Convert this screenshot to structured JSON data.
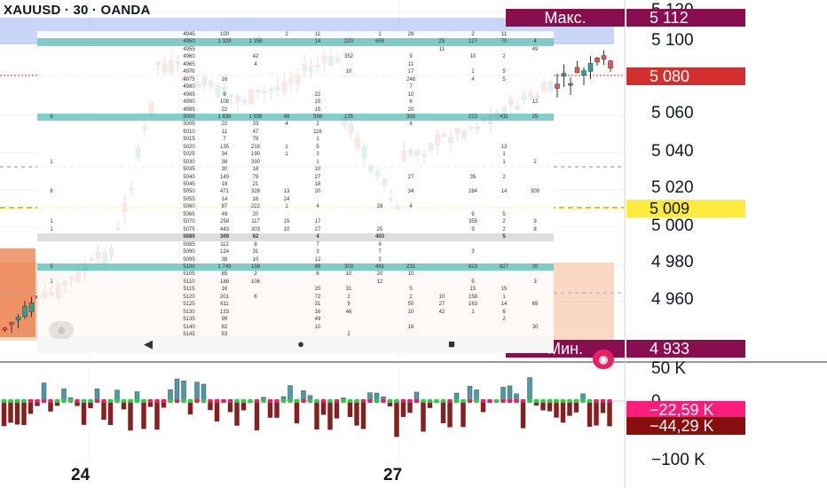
{
  "header": {
    "title": "XAUUSD · 30 · OANDA"
  },
  "price_axis": {
    "labels": [
      "5 120",
      "5 100",
      "5 060",
      "5 040",
      "5 020",
      "5 000",
      "4 980",
      "4 960"
    ],
    "max": {
      "name": "Макс.",
      "value": "5 112",
      "color": "#880e4f"
    },
    "current": {
      "value": "5 080",
      "color": "#d32f2f"
    },
    "level": {
      "value": "5 009",
      "color": "#ffeb3b"
    },
    "min": {
      "name": "Мин.",
      "value": "4 933",
      "color": "#880e4f"
    }
  },
  "indicator_axis": {
    "labels": [
      "50 K",
      "0",
      "−100 K"
    ],
    "badge_pos": {
      "value": "−22,59 K",
      "color": "#ff1d7a"
    },
    "badge_neg": {
      "value": "−44,29 K",
      "color": "#880e0e"
    }
  },
  "time_axis": {
    "labels": [
      "24",
      "27"
    ]
  },
  "dom": {
    "rows": [
      {
        "p": "4945",
        "c": [
          "",
          "100",
          "",
          "2",
          "11",
          "",
          "1",
          "28",
          "",
          "2",
          "11",
          "",
          ""
        ]
      },
      {
        "p": "4950",
        "c": [
          "",
          "1 329",
          "1 158",
          "",
          "14",
          "220",
          "659",
          "",
          "25",
          "127",
          "70",
          "4",
          ""
        ],
        "hl": true
      },
      {
        "p": "4955",
        "c": [
          "",
          "",
          "",
          "",
          "",
          "",
          "",
          "",
          "11",
          "",
          "",
          "49",
          ""
        ]
      },
      {
        "p": "4960",
        "c": [
          "",
          "",
          "42",
          "",
          "",
          "352",
          "",
          "9",
          "",
          "10",
          "2",
          "",
          ""
        ]
      },
      {
        "p": "4965",
        "c": [
          "",
          "",
          "4",
          "",
          "",
          "",
          "",
          "11",
          "",
          "",
          "",
          "",
          ""
        ]
      },
      {
        "p": "4970",
        "c": [
          "",
          "",
          "",
          "",
          "",
          "10",
          "",
          "17",
          "",
          "1",
          "5",
          "",
          ""
        ]
      },
      {
        "p": "4975",
        "c": [
          "",
          "16",
          "",
          "",
          "",
          "",
          "",
          "248",
          "",
          "4",
          "5",
          "",
          ""
        ]
      },
      {
        "p": "4980",
        "c": [
          "",
          "",
          "",
          "",
          "",
          "",
          "",
          "7",
          "",
          "",
          "",
          "",
          ""
        ]
      },
      {
        "p": "4985",
        "c": [
          "",
          "9",
          "",
          "",
          "22",
          "",
          "",
          "10",
          "",
          "",
          "",
          "",
          ""
        ]
      },
      {
        "p": "4990",
        "c": [
          "",
          "108",
          "",
          "",
          "15",
          "",
          "",
          "6",
          "",
          "",
          "",
          "12",
          ""
        ]
      },
      {
        "p": "4995",
        "c": [
          "",
          "22",
          "",
          "",
          "15",
          "",
          "",
          "20",
          "",
          "",
          "",
          "",
          ""
        ]
      },
      {
        "p": "5000",
        "c": [
          "",
          "1 836",
          "1 938",
          "48",
          "556",
          "135",
          "",
          "355",
          "",
          "223",
          "411",
          "25",
          "6"
        ],
        "hl": true
      },
      {
        "p": "5005",
        "c": [
          "",
          "22",
          "33",
          "4",
          "2",
          "",
          "",
          "8",
          "",
          "",
          "",
          "",
          ""
        ]
      },
      {
        "p": "5010",
        "c": [
          "",
          "11",
          "47",
          "",
          "116",
          "",
          "",
          "",
          "",
          "",
          "",
          "",
          ""
        ]
      },
      {
        "p": "5015",
        "c": [
          "",
          "7",
          "79",
          "",
          "1",
          "",
          "",
          "",
          "",
          "",
          "",
          "",
          ""
        ]
      },
      {
        "p": "5020",
        "c": [
          "",
          "135",
          "218",
          "1",
          "5",
          "",
          "",
          "",
          "",
          "",
          "13",
          "",
          ""
        ]
      },
      {
        "p": "5025",
        "c": [
          "",
          "34",
          "190",
          "1",
          "3",
          "",
          "",
          "",
          "",
          "",
          "1",
          "",
          ""
        ]
      },
      {
        "p": "5030",
        "c": [
          "",
          "38",
          "330",
          "",
          "1",
          "",
          "",
          "",
          "",
          "",
          "1",
          "2",
          "1"
        ]
      },
      {
        "p": "5035",
        "c": [
          "",
          "30",
          "18",
          "",
          "10",
          "",
          "",
          "",
          "",
          "",
          "",
          "",
          ""
        ]
      },
      {
        "p": "5040",
        "c": [
          "",
          "149",
          "79",
          "",
          "27",
          "",
          "",
          "27",
          "",
          "35",
          "2",
          "",
          ""
        ]
      },
      {
        "p": "5045",
        "c": [
          "",
          "18",
          "21",
          "",
          "18",
          "",
          "",
          "",
          "",
          "",
          "",
          "",
          ""
        ]
      },
      {
        "p": "5050",
        "c": [
          "",
          "471",
          "328",
          "13",
          "20",
          "",
          "",
          "34",
          "",
          "284",
          "14",
          "309",
          "8"
        ]
      },
      {
        "p": "5055",
        "c": [
          "",
          "14",
          "16",
          "24",
          "",
          "",
          "",
          "",
          "",
          "",
          "",
          "",
          ""
        ]
      },
      {
        "p": "5060",
        "c": [
          "",
          "87",
          "222",
          "1",
          "4",
          "",
          "28",
          "4",
          "",
          "",
          "",
          "",
          ""
        ]
      },
      {
        "p": "5065",
        "c": [
          "",
          "49",
          "20",
          "",
          "",
          "",
          "",
          "",
          "",
          "9",
          "5",
          "",
          ""
        ]
      },
      {
        "p": "5070",
        "c": [
          "",
          "258",
          "117",
          "15",
          "17",
          "",
          "",
          "",
          "",
          "355",
          "2",
          "9",
          "1"
        ]
      },
      {
        "p": "5075",
        "c": [
          "",
          "443",
          "303",
          "10",
          "27",
          "",
          "25",
          "",
          "",
          "9",
          "2",
          "8",
          "1"
        ]
      },
      {
        "p": "5080",
        "c": [
          "",
          "309",
          "62",
          "",
          "4",
          "",
          "403",
          "",
          "",
          "",
          "5",
          "",
          ""
        ],
        "cur": true
      },
      {
        "p": "5085",
        "c": [
          "",
          "112",
          "8",
          "",
          "7",
          "",
          "4",
          "",
          "",
          "",
          "",
          "",
          ""
        ]
      },
      {
        "p": "5090",
        "c": [
          "",
          "124",
          "31",
          "",
          "3",
          "",
          "7",
          "",
          "",
          "3",
          "",
          "",
          ""
        ]
      },
      {
        "p": "5095",
        "c": [
          "",
          "38",
          "10",
          "",
          "12",
          "",
          "3",
          "",
          "",
          "",
          "",
          "",
          ""
        ]
      },
      {
        "p": "5100",
        "c": [
          "",
          "1 749",
          "158",
          "",
          "86",
          "303",
          "491",
          "231",
          "",
          "823",
          "827",
          "20",
          "5"
        ],
        "hl": true
      },
      {
        "p": "5105",
        "c": [
          "",
          "85",
          "2",
          "",
          "6",
          "10",
          "20",
          "10",
          "",
          "",
          "",
          "",
          ""
        ]
      },
      {
        "p": "5110",
        "c": [
          "",
          "188",
          "106",
          "",
          "",
          "",
          "12",
          "",
          "",
          "5",
          "",
          "3",
          "1"
        ]
      },
      {
        "p": "5115",
        "c": [
          "",
          "16",
          "",
          "",
          "20",
          "31",
          "",
          "5",
          "",
          "15",
          "15",
          "",
          ""
        ]
      },
      {
        "p": "5120",
        "c": [
          "",
          "201",
          "6",
          "",
          "72",
          "2",
          "",
          "2",
          "10",
          "158",
          "1",
          "",
          ""
        ]
      },
      {
        "p": "5125",
        "c": [
          "",
          "611",
          "",
          "",
          "31",
          "9",
          "",
          "50",
          "27",
          "163",
          "14",
          "65",
          ""
        ]
      },
      {
        "p": "5130",
        "c": [
          "",
          "133",
          "",
          "",
          "16",
          "46",
          "",
          "10",
          "42",
          "1",
          "6",
          "",
          ""
        ]
      },
      {
        "p": "5135",
        "c": [
          "",
          "99",
          "",
          "",
          "49",
          "",
          "",
          "",
          "",
          "",
          "2",
          "",
          ""
        ]
      },
      {
        "p": "5140",
        "c": [
          "",
          "82",
          "",
          "",
          "10",
          "",
          "",
          "16",
          "",
          "",
          "",
          "30",
          ""
        ]
      },
      {
        "p": "5145",
        "c": [
          "",
          "53",
          "",
          "",
          "",
          "2",
          "",
          "",
          "",
          "",
          "",
          "",
          ""
        ]
      },
      {
        "p": "5150",
        "c": [
          "",
          "793",
          "146",
          "",
          "160",
          "",
          "",
          "357",
          "21",
          "104",
          "11",
          "",
          ""
        ]
      },
      {
        "p": "5155",
        "c": [
          "",
          "2",
          "",
          "",
          "",
          "",
          "",
          "13",
          "",
          "1",
          "",
          "",
          ""
        ]
      }
    ]
  }
}
